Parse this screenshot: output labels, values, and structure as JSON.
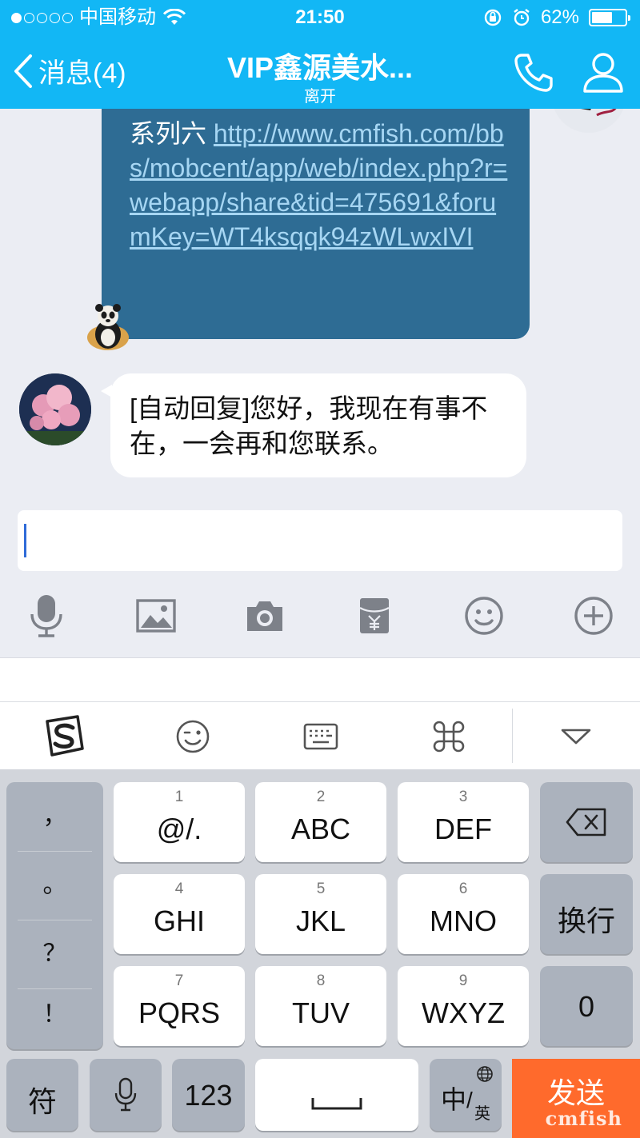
{
  "status": {
    "carrier": "中国移动",
    "time": "21:50",
    "battery_text": "62%",
    "battery_level": 0.62,
    "signal_bars_filled": 1,
    "signal_bars_total": 5
  },
  "nav": {
    "back_label": "消息(4)",
    "title": "VIP鑫源美水...",
    "subtitle": "离开",
    "call_icon": "phone-icon",
    "profile_icon": "person-icon"
  },
  "messages": [
    {
      "direction": "outgoing",
      "prefix_text": "系列六",
      "link_text": "http://www.cmfish.com/bbs/mobcent/app/web/index.php?r=webapp/share&tid=475691&forumKey=WT4ksqqk94zWLwxIVI"
    },
    {
      "direction": "incoming",
      "text": "[自动回复]您好，我现在有事不在，一会再和您联系。"
    }
  ],
  "input": {
    "value": "",
    "placeholder": ""
  },
  "toolbar": [
    "microphone-icon",
    "image-icon",
    "camera-icon",
    "red-packet-icon",
    "emoji-icon",
    "plus-icon"
  ],
  "keyboard_bar": [
    "sogou-logo-icon",
    "wink-emoji-icon",
    "keyboard-icon",
    "command-icon",
    "collapse-icon"
  ],
  "keyboard": {
    "punct": [
      "，",
      "。",
      "？",
      "！"
    ],
    "keys": [
      {
        "num": "1",
        "label": "@/."
      },
      {
        "num": "2",
        "label": "ABC"
      },
      {
        "num": "3",
        "label": "DEF"
      },
      {
        "num": "4",
        "label": "GHI"
      },
      {
        "num": "5",
        "label": "JKL"
      },
      {
        "num": "6",
        "label": "MNO"
      },
      {
        "num": "7",
        "label": "PQRS"
      },
      {
        "num": "8",
        "label": "TUV"
      },
      {
        "num": "9",
        "label": "WXYZ"
      }
    ],
    "newline": "换行",
    "zero": "0",
    "symbol": "符",
    "numbers": "123",
    "lang_main": "中",
    "lang_sub": "英",
    "send": "发送"
  },
  "watermark": "cmfish",
  "colors": {
    "accent": "#12b7f5",
    "send": "#ff6a2c",
    "outgoing_bubble": "#2e6c94"
  }
}
